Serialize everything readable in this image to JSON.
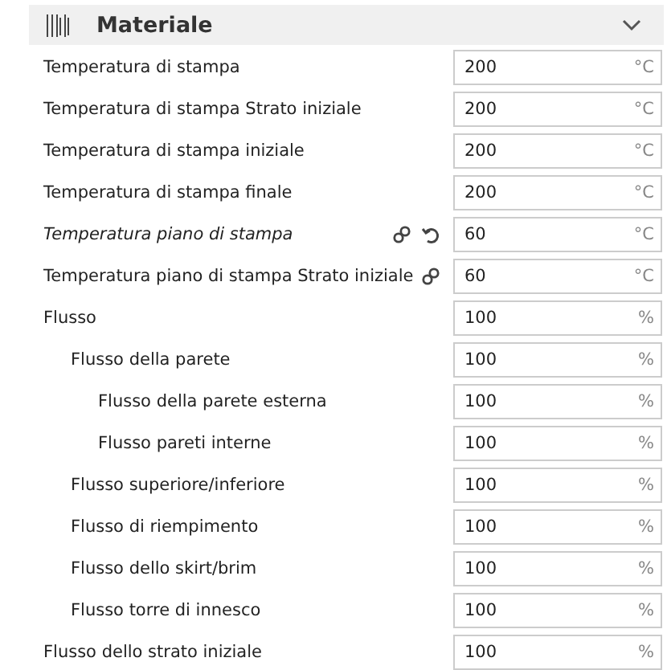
{
  "section": {
    "title": "Materiale",
    "expanded": true
  },
  "settings": [
    {
      "label": "Temperatura di stampa",
      "value": "200",
      "unit": "°C",
      "overridden": false,
      "linked": false,
      "resettable": false
    },
    {
      "label": "Temperatura di stampa Strato iniziale",
      "value": "200",
      "unit": "°C",
      "overridden": false,
      "linked": false,
      "resettable": false
    },
    {
      "label": "Temperatura di stampa iniziale",
      "value": "200",
      "unit": "°C",
      "overridden": false,
      "linked": false,
      "resettable": false
    },
    {
      "label": "Temperatura di stampa finale",
      "value": "200",
      "unit": "°C",
      "overridden": false,
      "linked": false,
      "resettable": false
    },
    {
      "label": "Temperatura piano di stampa",
      "value": "60",
      "unit": "°C",
      "overridden": true,
      "linked": true,
      "resettable": true
    },
    {
      "label": "Temperatura piano di stampa Strato iniziale",
      "value": "60",
      "unit": "°C",
      "overridden": false,
      "linked": true,
      "resettable": false
    },
    {
      "label": "Flusso",
      "value": "100",
      "unit": "%",
      "overridden": false,
      "linked": false,
      "resettable": false,
      "children": [
        {
          "label": "Flusso della parete",
          "value": "100",
          "unit": "%",
          "overridden": false,
          "linked": false,
          "resettable": false,
          "children": [
            {
              "label": "Flusso della parete esterna",
              "value": "100",
              "unit": "%",
              "overridden": false,
              "linked": false,
              "resettable": false
            },
            {
              "label": "Flusso pareti interne",
              "value": "100",
              "unit": "%",
              "overridden": false,
              "linked": false,
              "resettable": false
            }
          ]
        },
        {
          "label": "Flusso superiore/inferiore",
          "value": "100",
          "unit": "%",
          "overridden": false,
          "linked": false,
          "resettable": false
        },
        {
          "label": "Flusso di riempimento",
          "value": "100",
          "unit": "%",
          "overridden": false,
          "linked": false,
          "resettable": false
        },
        {
          "label": "Flusso dello skirt/brim",
          "value": "100",
          "unit": "%",
          "overridden": false,
          "linked": false,
          "resettable": false
        },
        {
          "label": "Flusso torre di innesco",
          "value": "100",
          "unit": "%",
          "overridden": false,
          "linked": false,
          "resettable": false
        }
      ]
    },
    {
      "label": "Flusso dello strato iniziale",
      "value": "100",
      "unit": "%",
      "overridden": false,
      "linked": false,
      "resettable": false
    }
  ]
}
